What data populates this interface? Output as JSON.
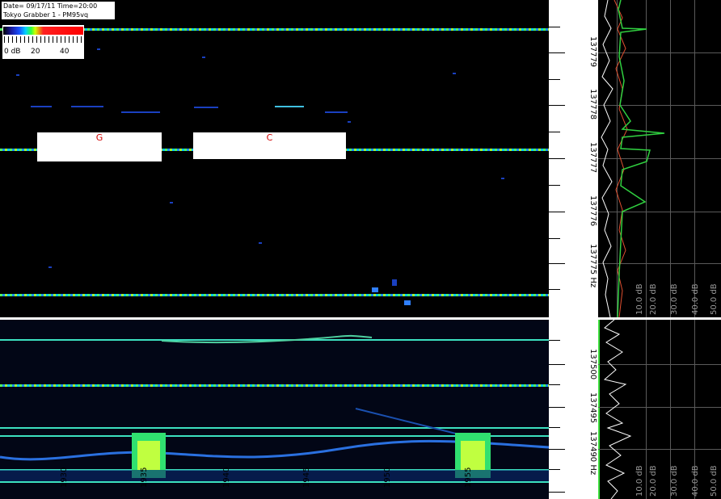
{
  "info": {
    "line1": "Date= 09/17/11  Time=20:00",
    "line2": "Tokyo Grabber 1 - PM95vq"
  },
  "legend": {
    "labels": [
      "0 dB",
      "20",
      "40"
    ]
  },
  "annotations": {
    "g": "G",
    "c": "C"
  },
  "axis_top": {
    "freq_labels": [
      "137779",
      "137778",
      "137777",
      "137776",
      "137775 Hz"
    ]
  },
  "axis_bottom": {
    "freq_labels": [
      "137500",
      "137495",
      "137490 Hz"
    ]
  },
  "time_labels": [
    "1930",
    "1935",
    "1940",
    "1945",
    "1950",
    "1955"
  ],
  "spectrum_top": {
    "db_labels": [
      "10.0 dB",
      "20.0 dB",
      "30.0 dB",
      "40.0 dB",
      "50.0 dB"
    ]
  },
  "spectrum_bottom": {
    "db_labels": [
      "10.0 dB",
      "20.0 dB",
      "30.0 dB",
      "40.0 dB",
      "50.0 dB"
    ]
  },
  "colors": {
    "background": "#000000",
    "carrier": "#50ff60",
    "annotation_text": "#d00000",
    "grid": "#5a5a5a"
  }
}
